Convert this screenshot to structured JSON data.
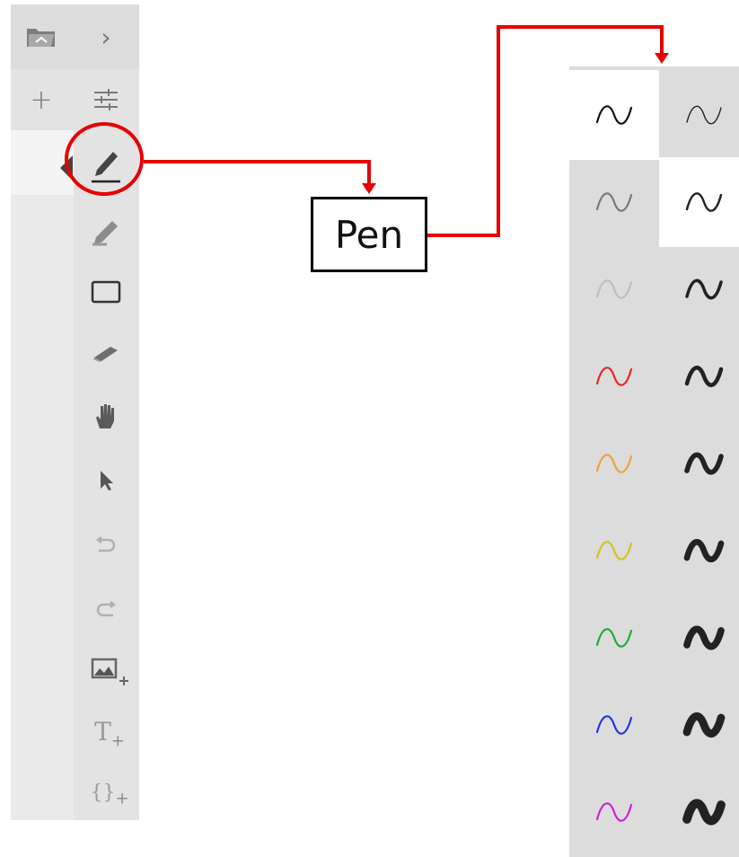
{
  "toolbar": {
    "tools": [
      {
        "name": "open-folder",
        "icon": "folder-open-icon"
      },
      {
        "name": "expand",
        "icon": "chevron-right-icon"
      },
      {
        "name": "add",
        "icon": "plus-icon"
      },
      {
        "name": "settings",
        "icon": "sliders-icon"
      },
      {
        "name": "pen",
        "icon": "pen-icon",
        "selected": true
      },
      {
        "name": "highlighter",
        "icon": "highlighter-icon"
      },
      {
        "name": "rectangle",
        "icon": "rectangle-icon"
      },
      {
        "name": "eraser",
        "icon": "eraser-icon"
      },
      {
        "name": "pan",
        "icon": "hand-icon"
      },
      {
        "name": "select",
        "icon": "pointer-arrow-icon"
      },
      {
        "name": "undo",
        "icon": "undo-icon"
      },
      {
        "name": "redo",
        "icon": "redo-icon"
      },
      {
        "name": "insert-image",
        "icon": "image-plus-icon"
      },
      {
        "name": "insert-text",
        "icon": "text-plus-icon",
        "glyph": "T",
        "sub": "+"
      },
      {
        "name": "insert-code",
        "icon": "braces-plus-icon",
        "glyph": "{}",
        "sub": "+"
      }
    ]
  },
  "annotation": {
    "callout_label": "Pen",
    "highlight_color": "#e60000"
  },
  "pen_panel": {
    "colors": [
      {
        "name": "black",
        "hex": "#111111"
      },
      {
        "name": "dark-gray",
        "hex": "#777777"
      },
      {
        "name": "light-gray",
        "hex": "#bdbdbd"
      },
      {
        "name": "red",
        "hex": "#ee2222"
      },
      {
        "name": "orange",
        "hex": "#f0a040"
      },
      {
        "name": "yellow",
        "hex": "#d8c020"
      },
      {
        "name": "green",
        "hex": "#22aa33"
      },
      {
        "name": "blue",
        "hex": "#2233ee"
      },
      {
        "name": "magenta",
        "hex": "#cc22cc"
      }
    ],
    "thicknesses": [
      1,
      2,
      3,
      4,
      5,
      6,
      7,
      8,
      9
    ],
    "selected_color": "black",
    "selected_thickness": 2
  }
}
